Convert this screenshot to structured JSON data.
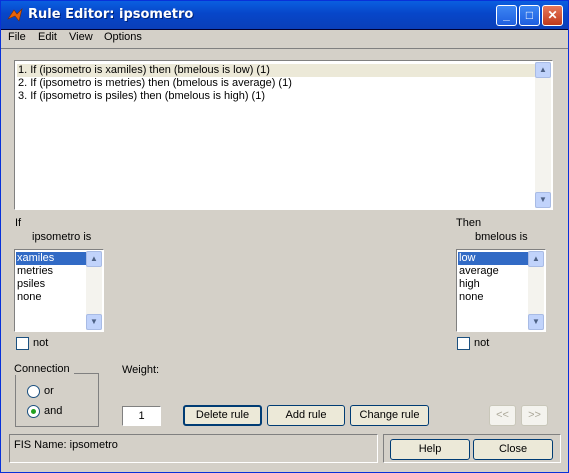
{
  "window": {
    "title": "Rule Editor: ipsometro",
    "controls": [
      "_",
      "□",
      "✕"
    ]
  },
  "menu": [
    "File",
    "Edit",
    "View",
    "Options"
  ],
  "rules": [
    "1. If (ipsometro is xamiles) then (bmelous is low) (1)",
    "2. If (ipsometro is metries) then (bmelous is average) (1)",
    "3. If (ipsometro is psiles) then (bmelous is high) (1)"
  ],
  "input": {
    "if_label": "If",
    "var_label": "ipsometro is",
    "options": [
      "xamiles",
      "metries",
      "psiles",
      "none"
    ],
    "selected": 0,
    "not_label": "not"
  },
  "output": {
    "then_label": "Then",
    "var_label": "bmelous is",
    "options": [
      "low",
      "average",
      "high",
      "none"
    ],
    "selected": 0,
    "not_label": "not"
  },
  "connection": {
    "title": "Connection",
    "or_label": "or",
    "and_label": "and",
    "selected": "and"
  },
  "weight": {
    "label": "Weight:",
    "value": "1"
  },
  "buttons": {
    "delete": "Delete rule",
    "add": "Add rule",
    "change": "Change rule",
    "prev": "<<",
    "next": ">>",
    "help": "Help",
    "close": "Close"
  },
  "status": {
    "text": "FIS Name: ipsometro"
  }
}
